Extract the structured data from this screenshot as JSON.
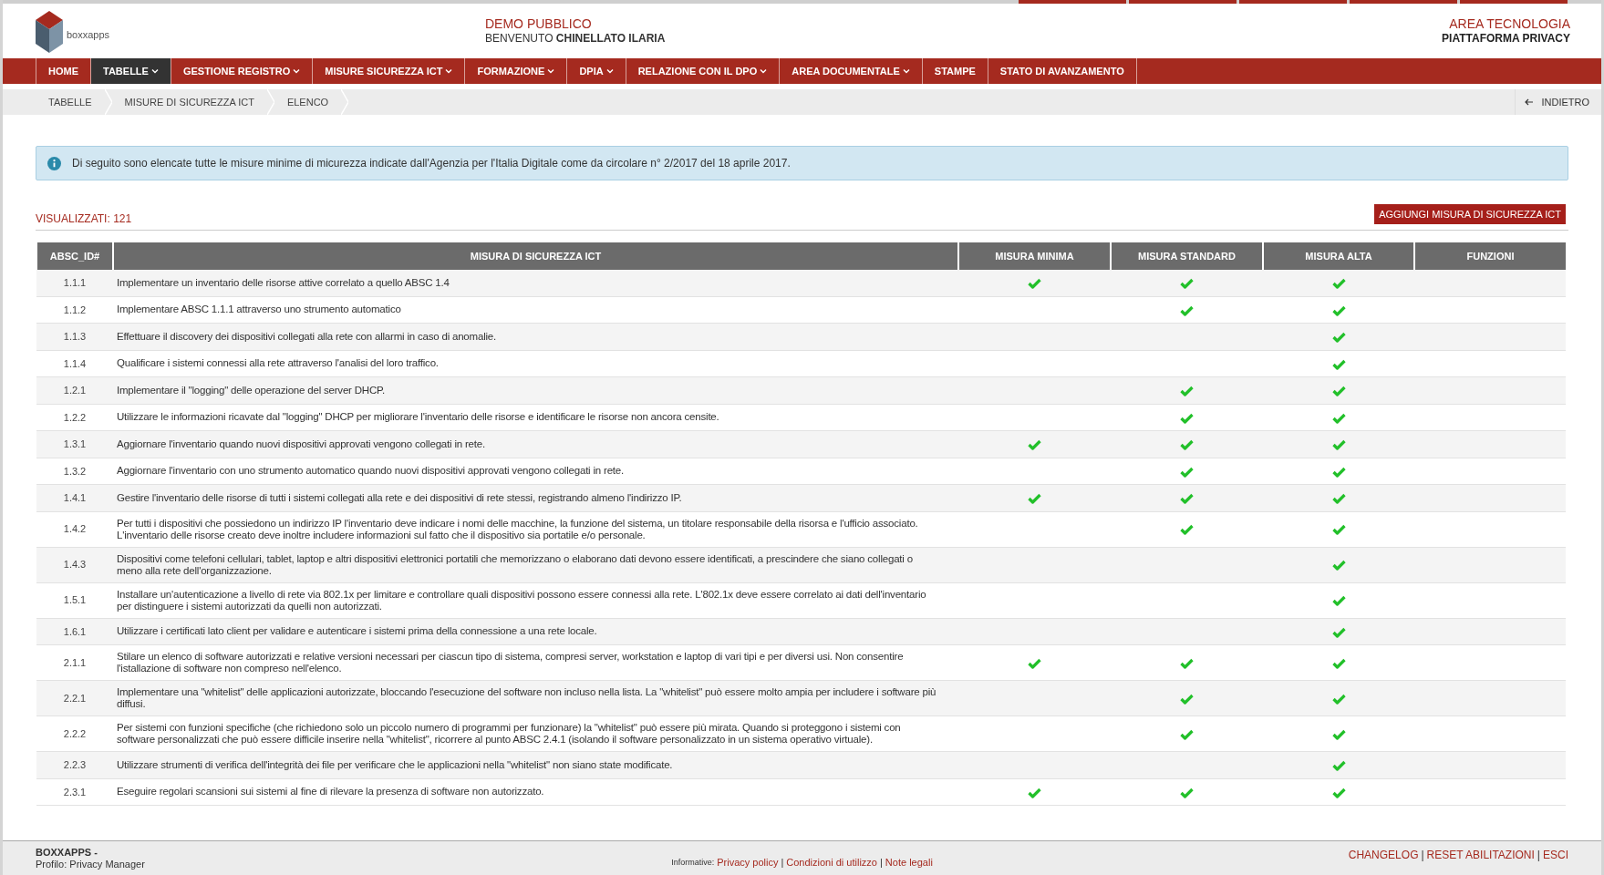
{
  "logo": {
    "text": "boxxapps"
  },
  "header": {
    "demo": "DEMO PUBBLICO",
    "welcome": "BENVENUTO **CHINELLATO ILARIA**",
    "area": "AREA TECNOLOGIA",
    "platform": "PIATTAFORMA PRIVACY"
  },
  "nav": [
    {
      "label": "HOME",
      "dropdown": false,
      "selected": false
    },
    {
      "label": "TABELLE",
      "dropdown": true,
      "selected": true
    },
    {
      "label": "GESTIONE REGISTRO",
      "dropdown": true,
      "selected": false
    },
    {
      "label": "MISURE SICUREZZA ICT",
      "dropdown": true,
      "selected": false
    },
    {
      "label": "FORMAZIONE",
      "dropdown": true,
      "selected": false
    },
    {
      "label": "DPIA",
      "dropdown": true,
      "selected": false
    },
    {
      "label": "RELAZIONE CON IL DPO",
      "dropdown": true,
      "selected": false
    },
    {
      "label": "AREA DOCUMENTALE",
      "dropdown": true,
      "selected": false
    },
    {
      "label": "STAMPE",
      "dropdown": false,
      "selected": false
    },
    {
      "label": "STATO DI AVANZAMENTO",
      "dropdown": false,
      "selected": false
    }
  ],
  "breadcrumb": [
    "TABELLE",
    "MISURE DI SICUREZZA ICT",
    "ELENCO"
  ],
  "back_button": "INDIETRO",
  "info": "Di seguito sono elencate tutte le misure minime di micurezza indicate dall'Agenzia per l'Italia Digitale come da circolare n° 2/2017 del 18 aprile 2017.",
  "count": "VISUALIZZATI: 121",
  "add_button": "AGGIUNGI MISURA DI SICUREZZA ICT",
  "table": {
    "columns": [
      "ABSC_ID#",
      "MISURA DI SICUREZZA ICT",
      "MISURA MINIMA",
      "MISURA STANDARD",
      "MISURA ALTA",
      "FUNZIONI"
    ],
    "rows": [
      {
        "id": "1.1.1",
        "text": "Implementare un inventario delle risorse attive correlato a quello ABSC 1.4",
        "minima": true,
        "standard": true,
        "alta": true
      },
      {
        "id": "1.1.2",
        "text": "Implementare ABSC 1.1.1 attraverso uno strumento automatico",
        "minima": false,
        "standard": true,
        "alta": true
      },
      {
        "id": "1.1.3",
        "text": "Effettuare il discovery dei dispositivi collegati alla rete con allarmi in caso di anomalie.",
        "minima": false,
        "standard": false,
        "alta": true
      },
      {
        "id": "1.1.4",
        "text": "Qualificare i sistemi connessi alla rete attraverso l'analisi del loro traffico.",
        "minima": false,
        "standard": false,
        "alta": true
      },
      {
        "id": "1.2.1",
        "text": "Implementare il \"logging\" delle operazione del server DHCP.",
        "minima": false,
        "standard": true,
        "alta": true
      },
      {
        "id": "1.2.2",
        "text": "Utilizzare le informazioni ricavate dal \"logging\" DHCP per migliorare l'inventario delle risorse e identificare le risorse non ancora censite.",
        "minima": false,
        "standard": true,
        "alta": true
      },
      {
        "id": "1.3.1",
        "text": "Aggiornare l'inventario quando nuovi dispositivi approvati vengono collegati in rete.",
        "minima": true,
        "standard": true,
        "alta": true
      },
      {
        "id": "1.3.2",
        "text": "Aggiornare l'inventario con uno strumento automatico quando nuovi dispositivi approvati vengono collegati in rete.",
        "minima": false,
        "standard": true,
        "alta": true
      },
      {
        "id": "1.4.1",
        "text": "Gestire l'inventario delle risorse di tutti i sistemi collegati alla rete e dei dispositivi di rete stessi, registrando almeno l'indirizzo IP.",
        "minima": true,
        "standard": true,
        "alta": true
      },
      {
        "id": "1.4.2",
        "text": "Per tutti i dispositivi che possiedono un indirizzo IP l'inventario deve indicare i nomi delle macchine, la funzione del sistema, un titolare responsabile della risorsa e l'ufficio associato. L'inventario delle risorse creato deve inoltre includere informazioni sul fatto che il dispositivo sia portatile e/o personale.",
        "minima": false,
        "standard": true,
        "alta": true
      },
      {
        "id": "1.4.3",
        "text": "Dispositivi come telefoni cellulari, tablet, laptop e altri dispositivi elettronici portatili che memorizzano o elaborano dati devono essere identificati, a prescindere che siano collegati o meno alla rete dell'organizzazione.",
        "minima": false,
        "standard": false,
        "alta": true
      },
      {
        "id": "1.5.1",
        "text": "Installare un'autenticazione a livello di rete via 802.1x per limitare e controllare quali dispositivi possono essere connessi alla rete. L'802.1x deve essere correlato ai dati dell'inventario per distinguere i sistemi autorizzati da quelli non autorizzati.",
        "minima": false,
        "standard": false,
        "alta": true
      },
      {
        "id": "1.6.1",
        "text": "Utilizzare i certificati lato client per validare e autenticare i sistemi prima della connessione a una rete locale.",
        "minima": false,
        "standard": false,
        "alta": true
      },
      {
        "id": "2.1.1",
        "text": "Stilare un elenco di software autorizzati e relative versioni necessari per ciascun tipo di sistema, compresi server, workstation e laptop di vari tipi e per diversi usi. Non consentire l'istallazione di software non compreso nell'elenco.",
        "minima": true,
        "standard": true,
        "alta": true
      },
      {
        "id": "2.2.1",
        "text": "Implementare una \"whitelist\" delle applicazioni autorizzate, bloccando l'esecuzione del software non incluso nella lista. La \"whitelist\" può essere molto ampia per includere i software più diffusi.",
        "minima": false,
        "standard": true,
        "alta": true
      },
      {
        "id": "2.2.2",
        "text": "Per sistemi con funzioni specifiche (che richiedono solo un piccolo numero di programmi per funzionare) la \"whitelist\" può essere più mirata. Quando si proteggono i sistemi con software personalizzati che può essere difficile inserire nella \"whitelist\", ricorrere al punto ABSC 2.4.1 (isolando il software personalizzato in un sistema operativo virtuale).",
        "minima": false,
        "standard": true,
        "alta": true
      },
      {
        "id": "2.2.3",
        "text": "Utilizzare strumenti di verifica dell'integrità dei file per verificare che le applicazioni nella \"whitelist\" non siano state modificate.",
        "minima": false,
        "standard": false,
        "alta": true
      },
      {
        "id": "2.3.1",
        "text": "Eseguire regolari scansioni sui sistemi al fine di rilevare la presenza di software non autorizzato.",
        "minima": true,
        "standard": true,
        "alta": true
      }
    ]
  },
  "footer": {
    "company": "BOXXAPPS -",
    "profile": "Profilo: Privacy Manager",
    "informative_label": "Informative:",
    "informative_links": [
      {
        "kind": "link",
        "text": "Privacy policy"
      },
      {
        "kind": "separator",
        "text": "|"
      },
      {
        "kind": "link",
        "text": "Condizioni di utilizzo"
      },
      {
        "kind": "separator",
        "text": "|"
      },
      {
        "kind": "link",
        "text": "Note legali"
      }
    ],
    "right_links": [
      {
        "kind": "link",
        "text": "CHANGELOG"
      },
      {
        "kind": "separator",
        "text": "|"
      },
      {
        "kind": "link",
        "text": "RESET ABILITAZIONI"
      },
      {
        "kind": "separator",
        "text": "|"
      },
      {
        "kind": "link",
        "text": "ESCI"
      }
    ]
  }
}
